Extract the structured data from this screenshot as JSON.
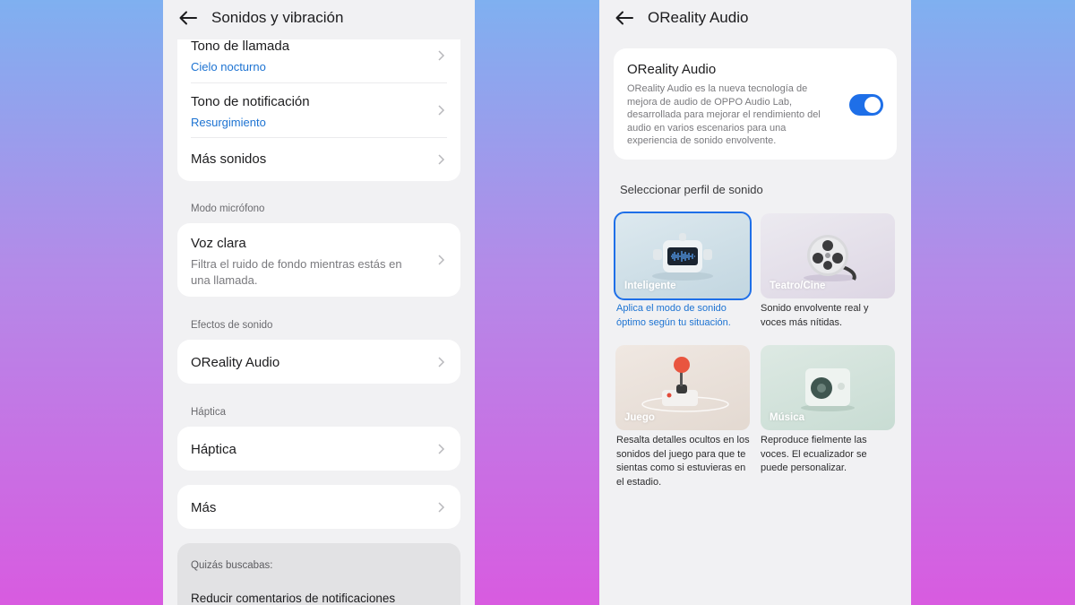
{
  "left_screen": {
    "header": {
      "title": "Sonidos y vibración"
    },
    "ringtone": {
      "title": "Tono de llamada",
      "value": "Cielo nocturno"
    },
    "notification_tone": {
      "title": "Tono de notificación",
      "value": "Resurgimiento"
    },
    "more_sounds": {
      "title": "Más sonidos"
    },
    "mic_section": "Modo micrófono",
    "clear_voice": {
      "title": "Voz clara",
      "desc": "Filtra el ruido de fondo mientras estás en una llamada."
    },
    "effects_section": "Efectos de sonido",
    "oreality": {
      "title": "OReality Audio"
    },
    "haptic_section": "Háptica",
    "haptic": {
      "title": "Háptica"
    },
    "more": {
      "title": "Más"
    },
    "suggestions": {
      "label": "Quizás buscabas:",
      "item": "Reducir comentarios de notificaciones"
    }
  },
  "right_screen": {
    "header": {
      "title": "OReality Audio"
    },
    "feature": {
      "title": "OReality Audio",
      "desc": "OReality Audio es la nueva tecnología de mejora de audio de OPPO Audio Lab, desarrollada para mejorar el rendimiento del audio en varios escenarios para una experiencia de sonido envolvente.",
      "enabled": true
    },
    "profile_heading": "Seleccionar perfil de sonido",
    "profiles": [
      {
        "label": "Inteligente",
        "desc": "Aplica el modo de sonido óptimo según tu situación.",
        "selected": true
      },
      {
        "label": "Teatro/Cine",
        "desc": "Sonido envolvente real y voces más nítidas.",
        "selected": false
      },
      {
        "label": "Juego",
        "desc": "Resalta detalles ocultos en los sonidos del juego para que te sientas como si estuvieras en el estadio.",
        "selected": false
      },
      {
        "label": "Música",
        "desc": "Reproduce fielmente las voces. El ecualizador se puede personalizar.",
        "selected": false
      }
    ]
  },
  "colors": {
    "accent": "#1e6fe8",
    "link": "#1d73d2",
    "screen_bg": "#f1f1f3"
  }
}
